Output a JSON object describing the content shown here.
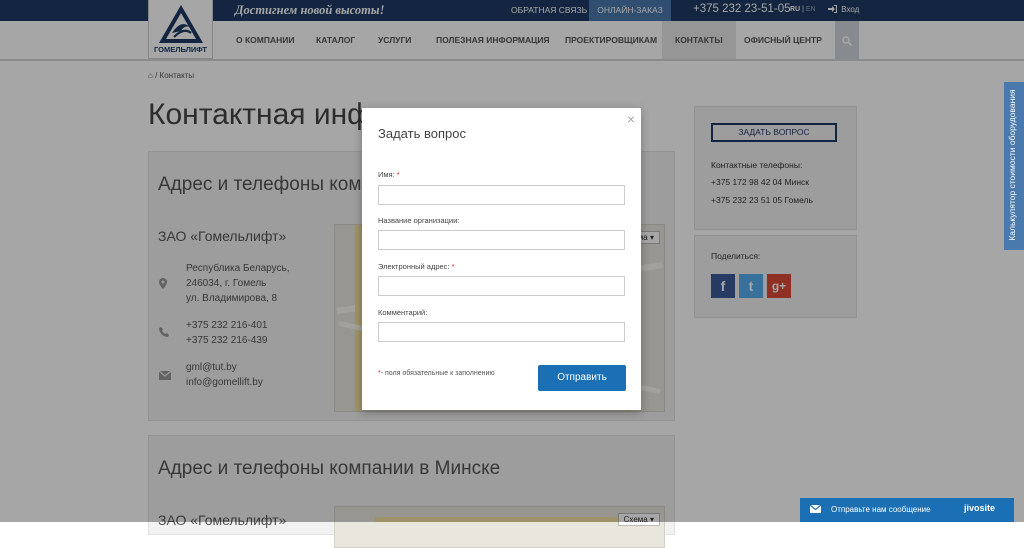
{
  "topbar": {
    "slogan": "Достигнем новой высоты!",
    "feedback": "Обратная связь",
    "online_order": "Онлайн-заказ",
    "phone": "+375 232 23-51-05",
    "lang_ru": "RU",
    "lang_sep": "|",
    "lang_en": "EN",
    "login": "Вход"
  },
  "logo": {
    "text": "ГОМЕЛЬЛИФТ"
  },
  "nav": {
    "items": [
      "О компании",
      "Каталог",
      "Услуги",
      "Полезная информация",
      "Проектировщикам",
      "Контакты",
      "Офисный центр"
    ],
    "active": "Контакты"
  },
  "breadcrumb": {
    "current": "Контакты",
    "sep": "/"
  },
  "page": {
    "title": "Контактная информация"
  },
  "gomel": {
    "title": "Адрес и телефоны компании в Гомеле",
    "company": "ЗАО «Гомельлифт»",
    "address": [
      "Республика Беларусь,",
      "246034, г. Гомель",
      "ул. Владимирова, 8"
    ],
    "phones": [
      "+375 232 216-401",
      "+375 232 216-439"
    ],
    "emails": [
      "gml@tut.by",
      "info@gomellift.by"
    ],
    "map_btn": "Схема"
  },
  "minsk": {
    "title": "Адрес и телефоны компании в Минске",
    "company": "ЗАО «Гомельлифт»",
    "map_btn": "Схема"
  },
  "sidebar": {
    "ask_button": "Задать вопрос",
    "phones_label": "Контактные телефоны:",
    "phones": [
      "+375 172 98 42 04 Минск",
      "+375 232 23 51 05 Гомель"
    ],
    "share_label": "Поделиться:",
    "social": [
      {
        "name": "facebook",
        "glyph": "f",
        "color": "#3b5998"
      },
      {
        "name": "twitter",
        "glyph": "t",
        "color": "#55acee"
      },
      {
        "name": "google-plus",
        "glyph": "g+",
        "color": "#dd4b39"
      }
    ]
  },
  "modal": {
    "title": "Задать вопрос",
    "close": "×",
    "fields": [
      {
        "label": "Имя:",
        "required": true,
        "value": ""
      },
      {
        "label": "Название организации:",
        "required": false,
        "value": ""
      },
      {
        "label": "Электронный адрес:",
        "required": true,
        "value": ""
      },
      {
        "label": "Комментарий:",
        "required": false,
        "value": ""
      }
    ],
    "required_star": "*",
    "required_note": "- поля обязательные к заполнению",
    "submit": "Отправить"
  },
  "calc_tab": {
    "label": "Калькулятор стоимости оборудования"
  },
  "chat": {
    "label": "Отправьте нам сообщение",
    "brand": "jivosite"
  },
  "colors": {
    "brand": "#1e3a63",
    "accent": "#4a79ad",
    "button": "#1a6fb5"
  }
}
